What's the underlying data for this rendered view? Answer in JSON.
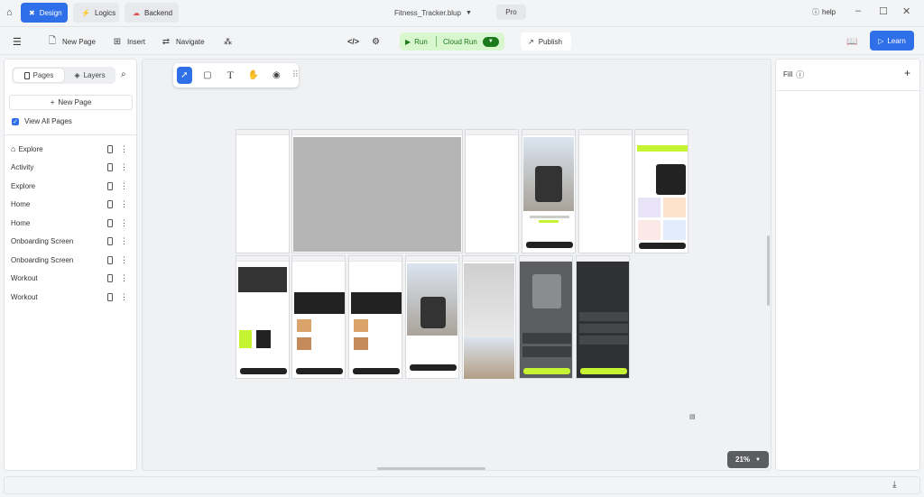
{
  "topbar": {
    "tabs": [
      {
        "label": "Design"
      },
      {
        "label": "Logics"
      },
      {
        "label": "Backend"
      }
    ],
    "file_name": "Fitness_Tracker.blup",
    "plan": "Pro",
    "help": "help"
  },
  "toolbar": {
    "new_page": "New Page",
    "insert": "Insert",
    "navigate": "Navigate",
    "run": "Run",
    "cloud_run": "Cloud Run",
    "publish": "Publish",
    "learn": "Learn"
  },
  "left_panel": {
    "tabs": [
      "Pages",
      "Layers"
    ],
    "new_page_button": "New Page",
    "view_all": "View All Pages",
    "pages": [
      "Explore",
      "Activity",
      "Explore",
      "Home",
      "Home",
      "Onboarding Screen",
      "Onboarding Screen",
      "Workout",
      "Workout"
    ]
  },
  "canvas": {
    "zoom": "21%"
  },
  "right_panel": {
    "fill_label": "Fill"
  },
  "colors": {
    "accent": "#2f6fe8",
    "run_green": "#1b7a1b",
    "lime": "#c6f432"
  }
}
